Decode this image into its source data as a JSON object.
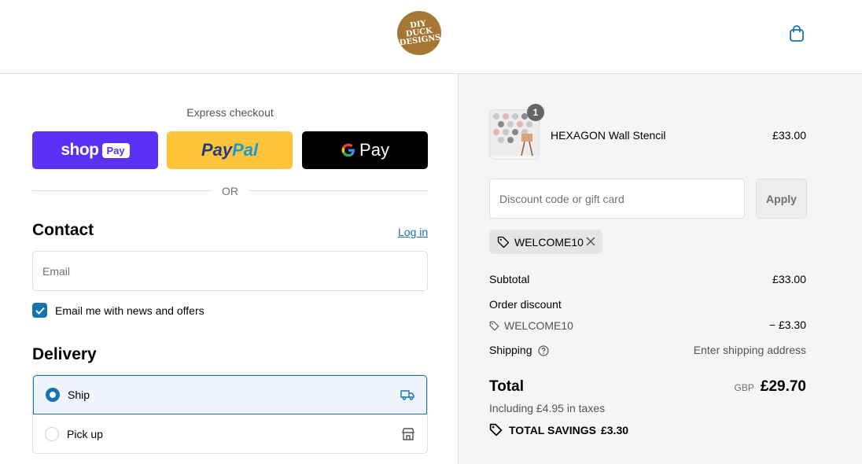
{
  "header": {
    "logo_text": "DIY DUCK DESIGNS",
    "cart_icon": "shopping-bag-icon"
  },
  "express": {
    "label": "Express checkout",
    "shop_pay": {
      "word": "shop",
      "pill": "Pay"
    },
    "paypal": {
      "part1": "Pay",
      "part2": "Pal"
    },
    "gpay": {
      "word": "Pay"
    },
    "or_text": "OR"
  },
  "contact": {
    "title": "Contact",
    "login_label": "Log in",
    "email_placeholder": "Email",
    "news_label": "Email me with news and offers",
    "news_checked": true
  },
  "delivery": {
    "title": "Delivery",
    "options": [
      {
        "label": "Ship",
        "selected": true,
        "icon": "truck-icon"
      },
      {
        "label": "Pick up",
        "selected": false,
        "icon": "store-icon"
      }
    ]
  },
  "summary": {
    "product": {
      "name": "HEXAGON Wall Stencil",
      "price": "£33.00",
      "quantity": "1"
    },
    "discount": {
      "placeholder": "Discount code or gift card",
      "apply_label": "Apply",
      "applied_code": "WELCOME10"
    },
    "subtotal_label": "Subtotal",
    "subtotal_value": "£33.00",
    "order_discount_label": "Order discount",
    "order_discount_code": "WELCOME10",
    "order_discount_value": "− £3.30",
    "shipping_label": "Shipping",
    "shipping_value": "Enter shipping address",
    "total_label": "Total",
    "currency": "GBP",
    "total_value": "£29.70",
    "tax_note": "Including £4.95 in taxes",
    "savings_label": "TOTAL SAVINGS",
    "savings_value": "£3.30"
  },
  "colors": {
    "accent": "#1773b0",
    "shop_pay": "#5a31f4",
    "paypal": "#ffc439",
    "logo": "#a57734"
  }
}
